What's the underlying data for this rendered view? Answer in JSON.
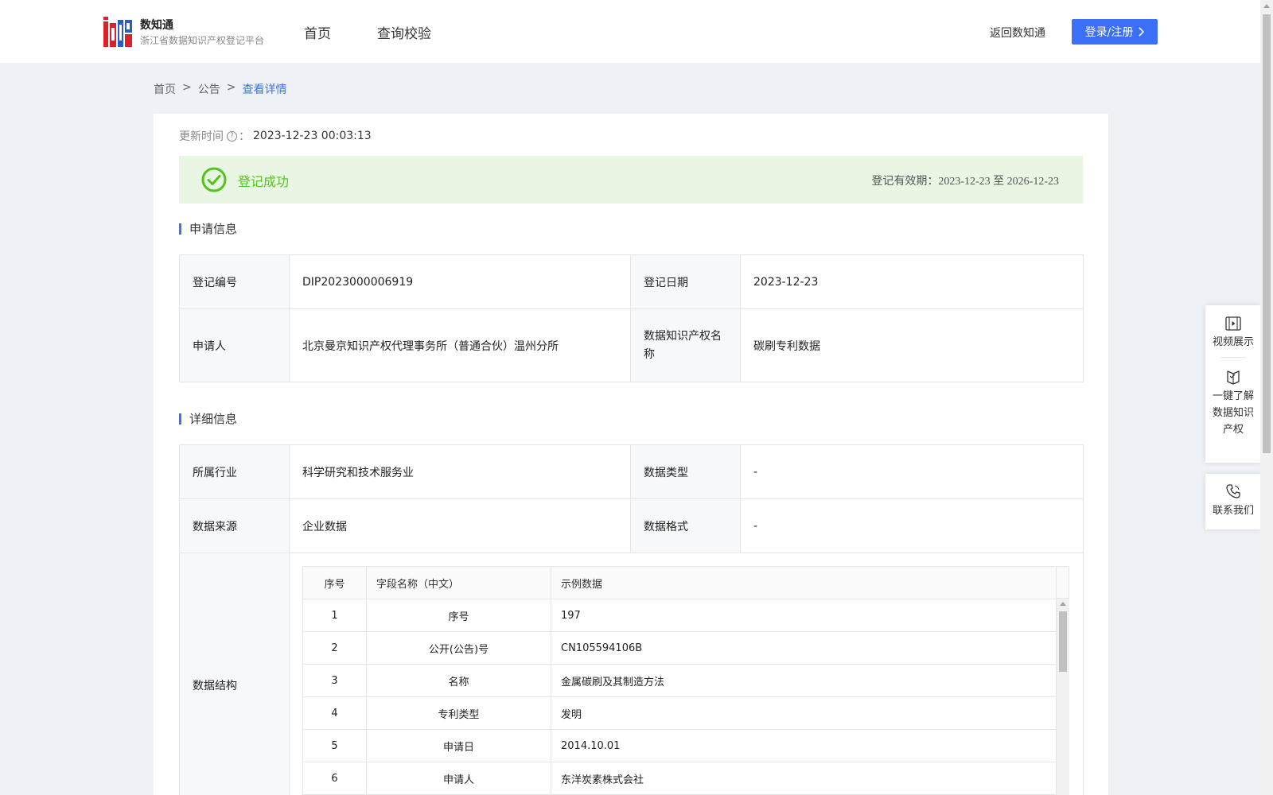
{
  "header": {
    "brand_name": "数知通",
    "brand_sub": "浙江省数据知识产权登记平台",
    "nav": [
      "首页",
      "查询校验"
    ],
    "back_link": "返回数知通",
    "login_label": "登录/注册"
  },
  "breadcrumb": {
    "items": [
      "首页",
      "公告",
      "查看详情"
    ],
    "separator": ">"
  },
  "update": {
    "label": "更新时间",
    "suffix": "：",
    "value": "2023-12-23 00:03:13"
  },
  "status": {
    "text": "登记成功",
    "validity_label": "登记有效期：",
    "validity_value": "2023-12-23 至 2026-12-23",
    "color": "#52c41a"
  },
  "sections": {
    "apply_title": "申请信息",
    "detail_title": "详细信息"
  },
  "apply": {
    "reg_no_label": "登记编号",
    "reg_no": "DIP2023000006919",
    "reg_date_label": "登记日期",
    "reg_date": "2023-12-23",
    "applicant_label": "申请人",
    "applicant": "北京曼京知识产权代理事务所（普通合伙）温州分所",
    "ip_name_label": "数据知识产权名称",
    "ip_name": "碳刷专利数据"
  },
  "detail": {
    "industry_label": "所属行业",
    "industry": "科学研究和技术服务业",
    "data_type_label": "数据类型",
    "data_type": "-",
    "source_label": "数据来源",
    "source": "企业数据",
    "format_label": "数据格式",
    "format": "-",
    "structure_label": "数据结构"
  },
  "structure": {
    "columns": [
      "序号",
      "字段名称（中文）",
      "示例数据"
    ],
    "rows": [
      [
        "1",
        "序号",
        "197"
      ],
      [
        "2",
        "公开(公告)号",
        "CN105594106B"
      ],
      [
        "3",
        "名称",
        "金属碳刷及其制造方法"
      ],
      [
        "4",
        "专利类型",
        "发明"
      ],
      [
        "5",
        "申请日",
        "2014.10.01"
      ],
      [
        "6",
        "申请人",
        "东洋炭素株式会社"
      ]
    ]
  },
  "float": {
    "video": "视频展示",
    "learn": "一键了解数据知识产权",
    "contact": "联系我们"
  },
  "colors": {
    "accent": "#3b6ff5",
    "success_bg": "#e8f6e3"
  }
}
